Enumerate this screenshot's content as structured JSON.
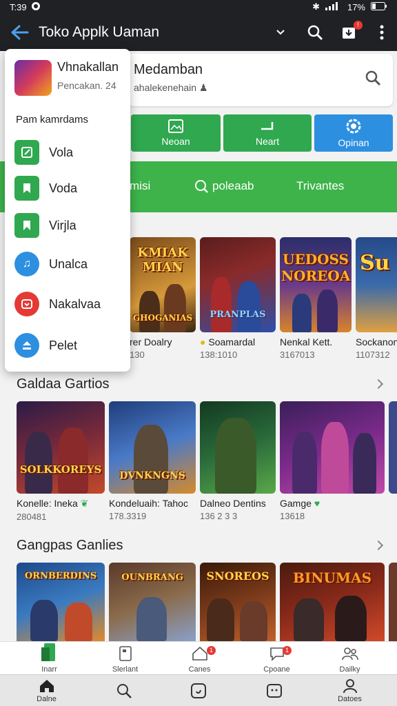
{
  "status": {
    "time": "T:39",
    "battery": "17%"
  },
  "appbar": {
    "title": "Toko Applk Uaman"
  },
  "search": {
    "title": "Medamban",
    "subtitle": "ahalekenehain"
  },
  "tiles": [
    {
      "label": "Neoan",
      "icon": "image-icon"
    },
    {
      "label": "Neart",
      "icon": "corner-icon"
    },
    {
      "label": "Opinan",
      "icon": "settings-icon"
    }
  ],
  "navrow": {
    "item1": "misi",
    "item2": "poleaab",
    "item3": "Trivantes"
  },
  "row1": [
    {
      "cover": "KMIAK MIAN",
      "sub": "GHOGANIAS",
      "name": "rer Doalry",
      "num": "130",
      "c1": "#7a4a1a",
      "c2": "#d79a3a"
    },
    {
      "cover": "",
      "sub": "PRANPLAS",
      "name": "Soamardal",
      "num": "138:1010",
      "c1": "#5a1d1d",
      "c2": "#2d4fa8"
    },
    {
      "cover": "UEDOSS NOREOA",
      "sub": "",
      "name": "Nenkal Kett.",
      "num": "3167013",
      "c1": "#2a2e6a",
      "c2": "#d8842a"
    },
    {
      "cover": "Su",
      "sub": "",
      "name": "Sockanon",
      "num": "1107312",
      "c1": "#264a8a",
      "c2": "#e0a040"
    }
  ],
  "section2": {
    "title": "Galdaa Gartios"
  },
  "row2": [
    {
      "cover": "SOLKKOREYS",
      "name": "Konelle: Ineka",
      "num": "280481",
      "c1": "#2b1b46",
      "c2": "#c44a2a"
    },
    {
      "cover": "DVNKNGNS",
      "name": "Kondeluaih: Tahoc",
      "num": "178.3319",
      "c1": "#1f3e7a",
      "c2": "#d68a2a"
    },
    {
      "cover": "",
      "name": "Dalneo Dentins",
      "num": "136 2 3 3",
      "c1": "#123a22",
      "c2": "#5aa84a"
    },
    {
      "cover": "",
      "name": "Gamge",
      "num": "13618",
      "c1": "#3a1f5a",
      "c2": "#c04aa8"
    }
  ],
  "section3": {
    "title": "Gangpas Ganlies"
  },
  "row3": [
    {
      "cover": "ORNBERDINS",
      "c1": "#1d4a8a",
      "c2": "#e08a2a"
    },
    {
      "cover": "OUNBRANG",
      "c1": "#5a3a2a",
      "c2": "#8aa0c8"
    },
    {
      "cover": "SNOREOS",
      "c1": "#3a1a0a",
      "c2": "#c0602a"
    },
    {
      "cover": "BINUMAS",
      "c1": "#4a1a0e",
      "c2": "#d04a2a"
    }
  ],
  "menu": {
    "header_title": "Vhnakallan",
    "header_sub": "Pencakan. 24",
    "section": "Pam kamrdams",
    "items": [
      {
        "label": "Vola",
        "icon": "edit-icon",
        "color": "#2fa84f"
      },
      {
        "label": "Voda",
        "icon": "tag-icon",
        "color": "#2fa84f"
      },
      {
        "label": "Virjla",
        "icon": "bookmark-icon",
        "color": "#2fa84f"
      },
      {
        "label": "Unalca",
        "icon": "music-icon",
        "color": "#2d8fe0"
      },
      {
        "label": "Nakalvaa",
        "icon": "store-icon",
        "color": "#e53935"
      },
      {
        "label": "Pelet",
        "icon": "download-icon",
        "color": "#2d8fe0"
      }
    ]
  },
  "bottom1": [
    {
      "label": "Inarr",
      "icon": "apps-icon"
    },
    {
      "label": "Slerlant",
      "icon": "tablet-icon"
    },
    {
      "label": "Canes",
      "icon": "home-icon",
      "badge": "1"
    },
    {
      "label": "Cpoane",
      "icon": "chat-icon",
      "badge": "1"
    },
    {
      "label": "Dailky",
      "icon": "people-icon"
    }
  ],
  "bottom2": [
    {
      "label": "Dalne",
      "icon": "home-icon"
    },
    {
      "label": "",
      "icon": "search-icon"
    },
    {
      "label": "",
      "icon": "smile-icon"
    },
    {
      "label": "",
      "icon": "face-icon"
    },
    {
      "label": "Datoes",
      "icon": "person-icon"
    }
  ]
}
